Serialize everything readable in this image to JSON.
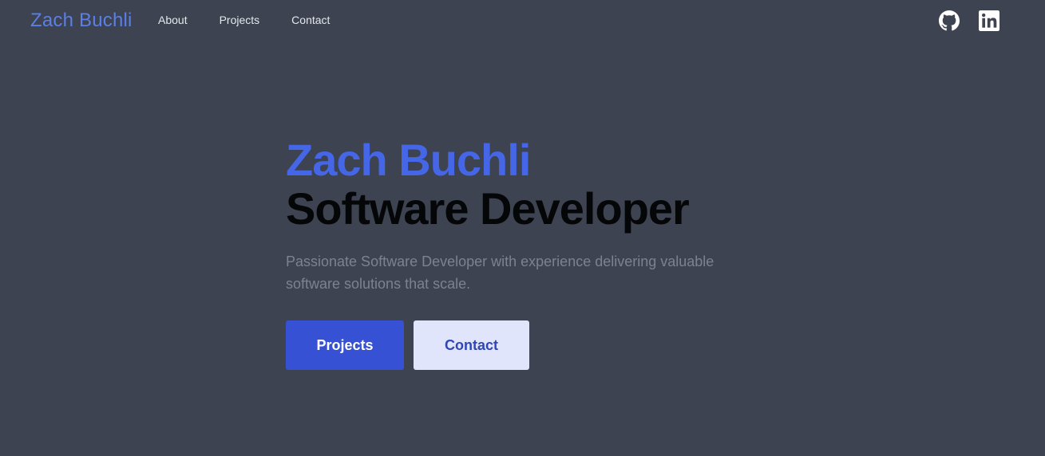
{
  "nav": {
    "brand": "Zach Buchli",
    "links": [
      {
        "label": "About"
      },
      {
        "label": "Projects"
      },
      {
        "label": "Contact"
      }
    ],
    "social": [
      {
        "icon": "github-icon"
      },
      {
        "icon": "linkedin-icon"
      }
    ]
  },
  "hero": {
    "name": "Zach Buchli",
    "role": "Software Developer",
    "description": "Passionate Software Developer with experience delivering valuable software solutions that scale.",
    "primary_button": "Projects",
    "secondary_button": "Contact"
  },
  "colors": {
    "background": "#3d4350",
    "accent": "#4566e6",
    "primary_button": "#3651d4",
    "secondary_button": "#e1e5fb"
  }
}
